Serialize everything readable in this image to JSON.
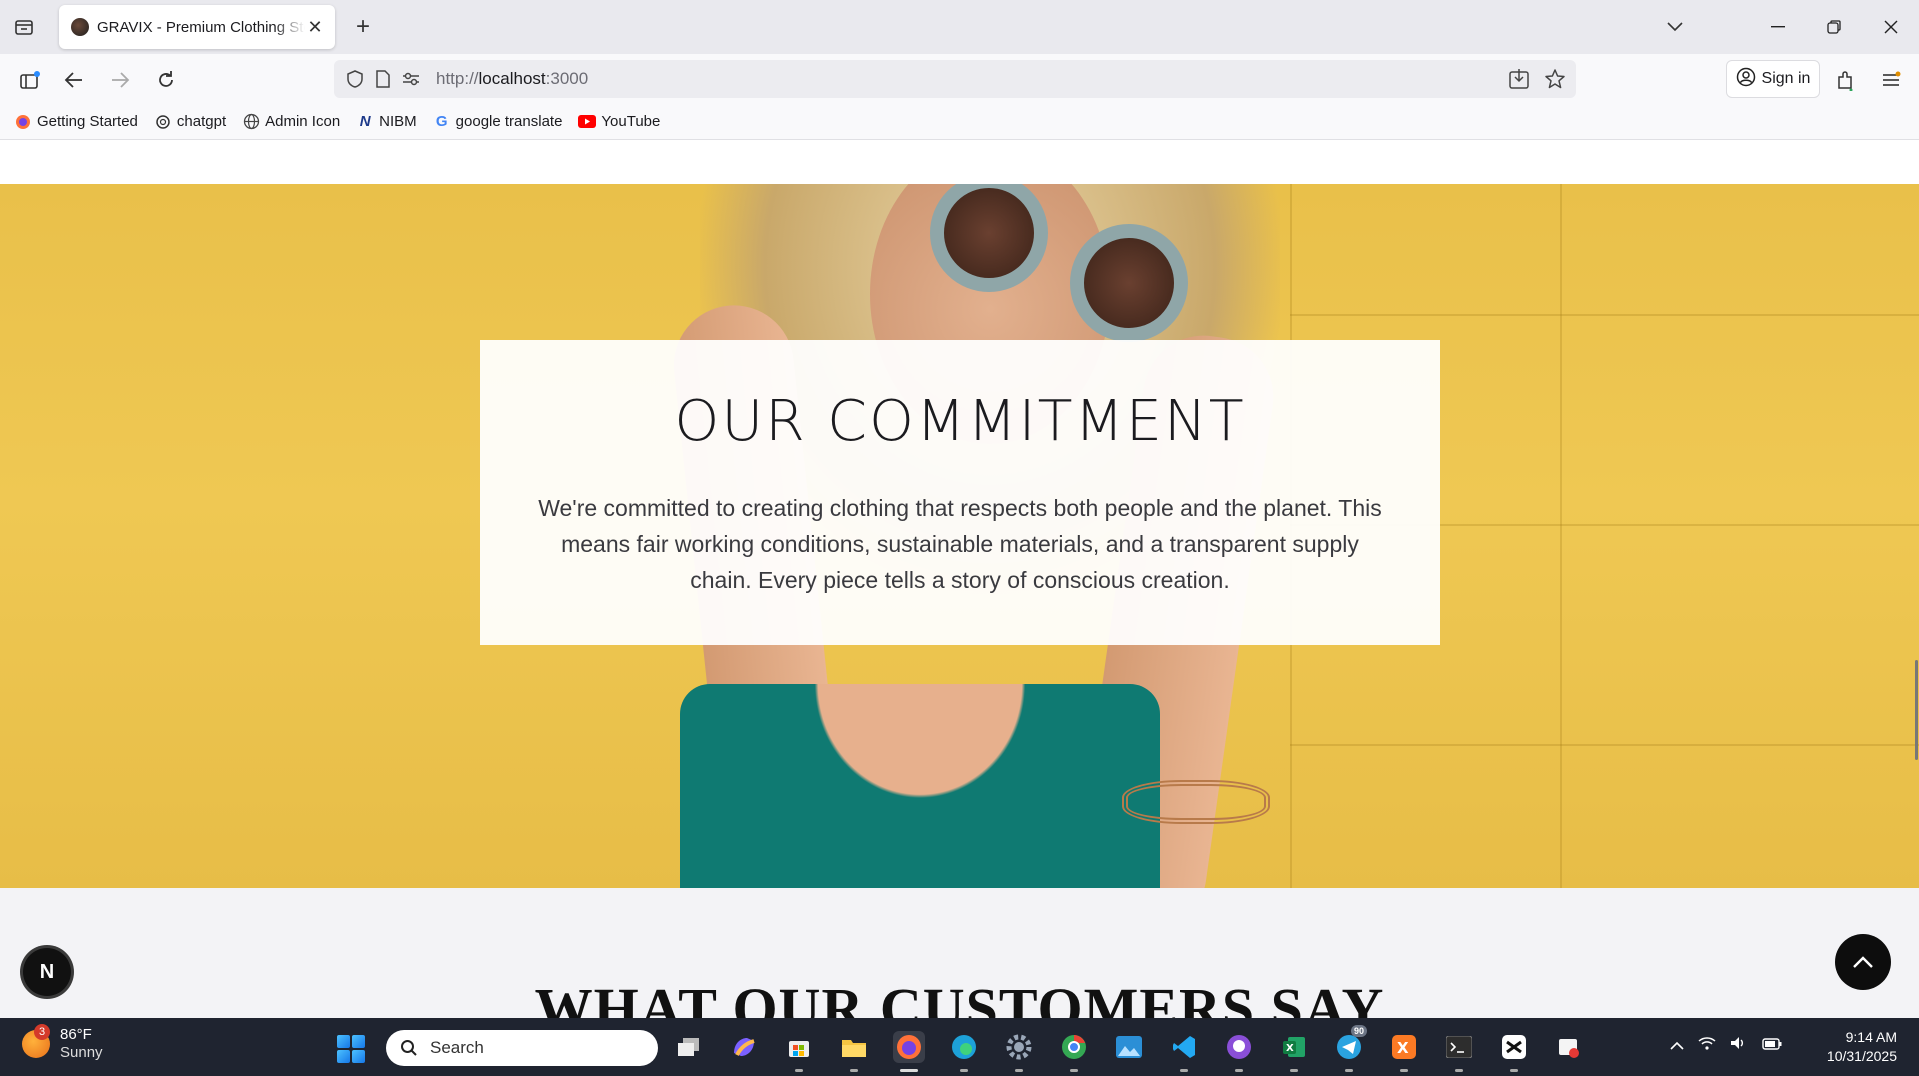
{
  "browser": {
    "tab_title": "GRAVIX - Premium Clothing Store",
    "url_prefix": "http://",
    "url_host": "localhost",
    "url_suffix": ":3000",
    "signin_label": "Sign in",
    "bookmarks": [
      {
        "label": "Getting Started",
        "icon": "firefox-icon"
      },
      {
        "label": "chatgpt",
        "icon": "chatgpt-icon"
      },
      {
        "label": "Admin Icon",
        "icon": "globe-icon"
      },
      {
        "label": "NIBM",
        "icon": "nibm-icon"
      },
      {
        "label": "google translate",
        "icon": "google-icon"
      },
      {
        "label": "YouTube",
        "icon": "youtube-icon"
      }
    ]
  },
  "page": {
    "commitment": {
      "title": "OUR COMMITMENT",
      "text": "We're committed to creating clothing that respects both people and the planet. This means fair working conditions, sustainable materials, and a transparent supply chain. Every piece tells a story of conscious creation."
    },
    "reviews_title": "WHAT OUR CUSTOMERS SAY",
    "n_badge": "N"
  },
  "taskbar": {
    "weather_badge": "3",
    "temperature": "86°F",
    "condition": "Sunny",
    "search_placeholder": "Search",
    "time": "9:14 AM",
    "date": "10/31/2025",
    "telegram_badge": "90"
  },
  "colors": {
    "hero_yellow": "#efc853",
    "accent_dark": "#0d0d0d",
    "taskbar_bg": "#1f2430"
  }
}
